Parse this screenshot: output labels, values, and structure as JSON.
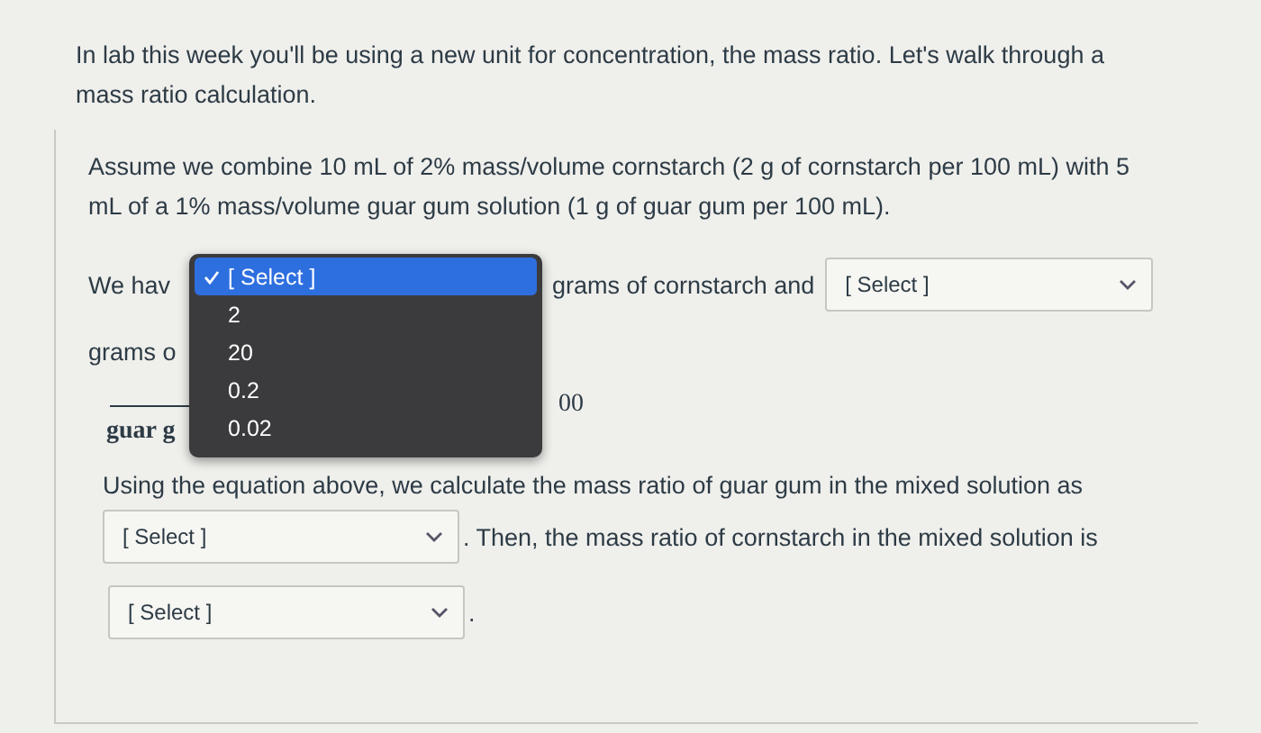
{
  "intro": "In lab this week you'll be using a new unit for concentration, the mass ratio. Let's walk through a mass ratio calculation.",
  "question": {
    "assume": "Assume we combine 10 mL of 2% mass/volume cornstarch (2 g of cornstarch per 100 mL) with 5 mL of a 1% mass/volume guar gum solution (1 g of guar gum per 100 mL).",
    "row_1": {
      "lead": "We hav",
      "menu": {
        "options": [
          {
            "label": "[ Select ]",
            "selected": true
          },
          {
            "label": "2",
            "selected": false
          },
          {
            "label": "20",
            "selected": false
          },
          {
            "label": "0.2",
            "selected": false
          },
          {
            "label": "0.02",
            "selected": false
          }
        ]
      },
      "after": "grams of cornstarch and",
      "select": {
        "value": "[ Select ]"
      }
    },
    "row_2": {
      "lead": "grams o"
    },
    "row_3": {
      "denominator": "guar g",
      "trailing": "00"
    },
    "sentence_1": "Using the equation above, we calculate the mass ratio of guar gum in the mixed solution as",
    "select_1": {
      "value": "[ Select ]"
    },
    "sentence_2": ". Then, the mass ratio of cornstarch in the mixed solution is",
    "select_2": {
      "value": "[ Select ]"
    },
    "end": "."
  }
}
